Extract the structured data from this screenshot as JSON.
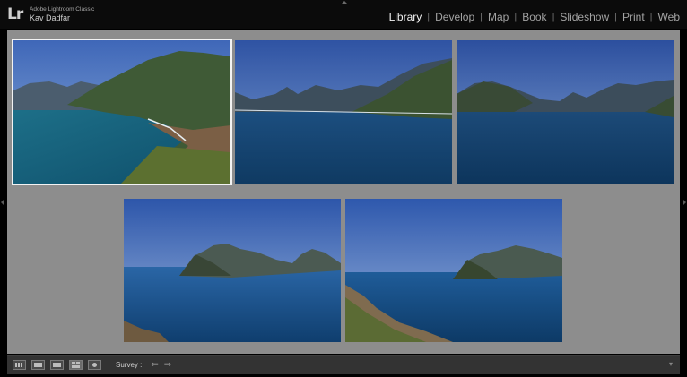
{
  "app": {
    "logo": "Lr",
    "product_name": "Adobe Lightroom Classic",
    "user_name": "Kav Dadfar"
  },
  "modules": [
    {
      "label": "Library",
      "active": true
    },
    {
      "label": "Develop",
      "active": false
    },
    {
      "label": "Map",
      "active": false
    },
    {
      "label": "Book",
      "active": false
    },
    {
      "label": "Slideshow",
      "active": false
    },
    {
      "label": "Print",
      "active": false
    },
    {
      "label": "Web",
      "active": false
    }
  ],
  "module_separator": "|",
  "survey": {
    "photos": [
      {
        "name": "bay-coastline-green-hill",
        "selected": true
      },
      {
        "name": "bay-mountains-wide-a",
        "selected": false
      },
      {
        "name": "bay-mountains-wide-b",
        "selected": false
      },
      {
        "name": "peninsula-clear-sky",
        "selected": false
      },
      {
        "name": "peninsula-foreground-shrubs",
        "selected": false
      }
    ]
  },
  "toolbar": {
    "view_modes": [
      "grid-view",
      "loupe-view",
      "compare-view",
      "survey-view",
      "people-view"
    ],
    "survey_label": "Survey :",
    "prev_arrow": "⇐",
    "next_arrow": "⇒",
    "menu_glyph": "▾"
  },
  "colors": {
    "stage_background": "#8d8d8d",
    "active_module": "#f2f2f2",
    "inactive_module": "#a3a3a3",
    "selection_border": "#f3f3f3"
  }
}
